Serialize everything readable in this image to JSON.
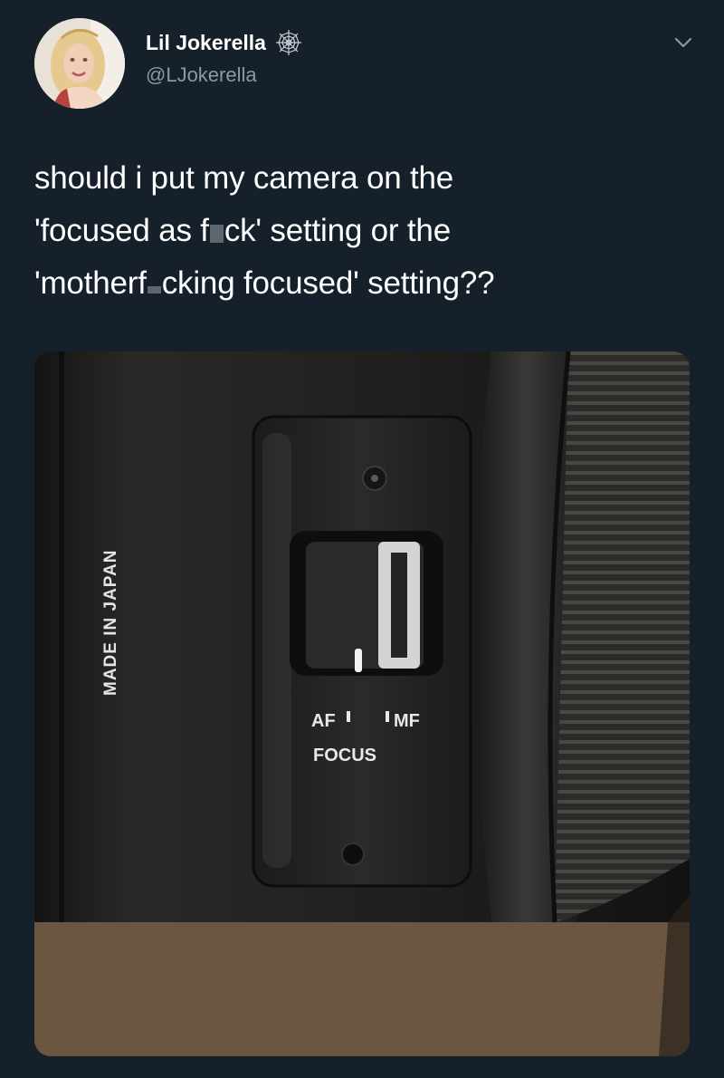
{
  "tweet": {
    "display_name": "Lil Jokerella",
    "handle": "@LJokerella",
    "badge_icon": "spiderweb-icon",
    "menu_icon": "chevron-down-icon",
    "text_lines": [
      {
        "before": "should i put my camera on the",
        "after": ""
      },
      {
        "before": "'focused as f",
        "after": "ck' setting or the"
      },
      {
        "before": "'motherf",
        "after": "cking focused' setting??"
      }
    ]
  },
  "photo": {
    "engraving": "MADE IN JAPAN",
    "switch_af": "AF",
    "switch_mf": "MF",
    "switch_label": "FOCUS"
  },
  "colors": {
    "background": "#15202b",
    "handle": "#8b98a5",
    "text": "#ffffff"
  }
}
